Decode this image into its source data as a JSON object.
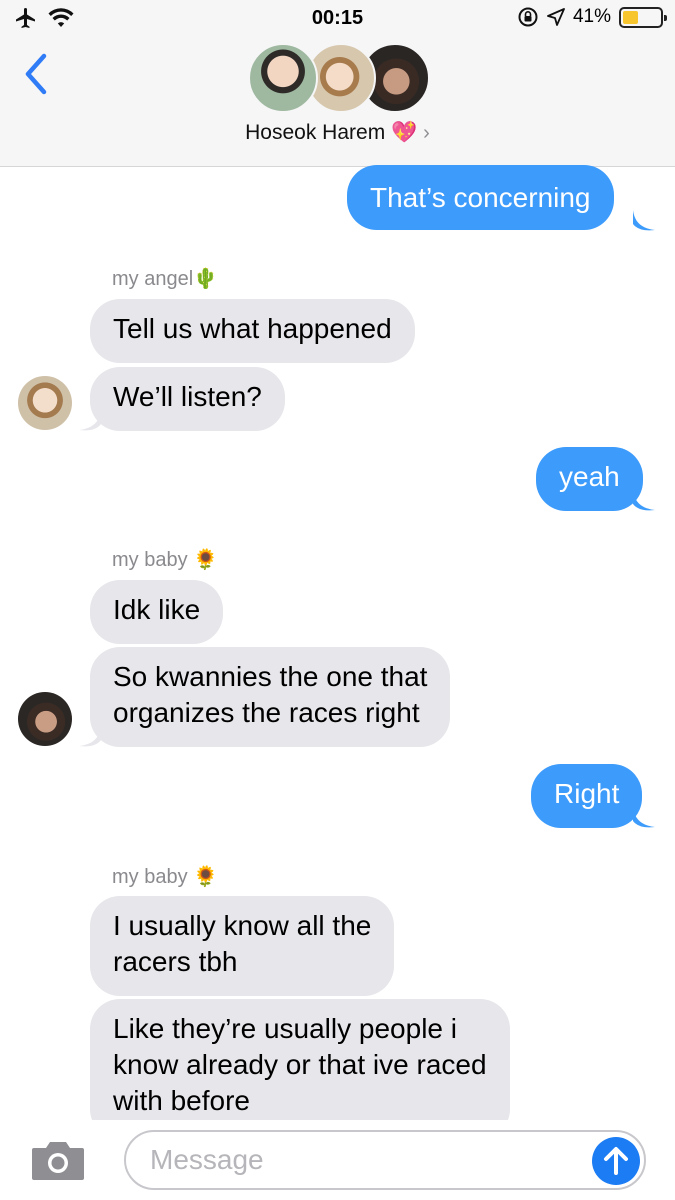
{
  "status_bar": {
    "time": "00:15",
    "battery": "41%",
    "battery_level": 0.41,
    "icons": [
      "airplane-icon",
      "wifi-icon",
      "rotation-lock-icon",
      "location-icon",
      "battery-icon"
    ]
  },
  "header": {
    "group_name": "Hoseok Harem 💖",
    "chevron": "›",
    "avatars": [
      "avatar-1",
      "avatar-2",
      "avatar-3"
    ]
  },
  "messages": [
    {
      "type": "sent",
      "text": "That’s concerning"
    },
    {
      "type": "sender",
      "text": "my angel🌵"
    },
    {
      "type": "received",
      "text": "Tell us what happened"
    },
    {
      "type": "received",
      "text": "We’ll listen?"
    },
    {
      "type": "sent",
      "text": "yeah"
    },
    {
      "type": "sender",
      "text": "my baby 🌻"
    },
    {
      "type": "received",
      "text": "Idk like"
    },
    {
      "type": "received",
      "line1": "So kwannies the one that",
      "line2": "organizes the races right"
    },
    {
      "type": "sent",
      "text": "Right"
    },
    {
      "type": "sender",
      "text": "my baby 🌻"
    },
    {
      "type": "received",
      "line1": "I usually know all the",
      "line2": "racers tbh"
    },
    {
      "type": "received",
      "line1": "Like they’re usually people i",
      "line2": "know already or that ive raced",
      "line3": "with before"
    }
  ],
  "composer": {
    "placeholder": "Message"
  },
  "colors": {
    "sent_bubble": "#3d9bfb",
    "received_bubble": "#e6e6eb",
    "accent": "#1c7cf4",
    "header_bg": "#f6f6f7"
  }
}
